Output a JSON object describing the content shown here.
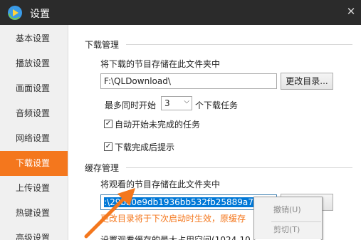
{
  "window": {
    "title": "设置",
    "close_glyph": "✕"
  },
  "sidebar": {
    "items": [
      {
        "label": "基本设置"
      },
      {
        "label": "播放设置"
      },
      {
        "label": "画面设置"
      },
      {
        "label": "音频设置"
      },
      {
        "label": "网络设置"
      },
      {
        "label": "下载设置",
        "active": true
      },
      {
        "label": "上传设置"
      },
      {
        "label": "热键设置"
      },
      {
        "label": "高级设置"
      }
    ]
  },
  "download": {
    "section_title": "下载管理",
    "save_label": "将下载的节目存储在此文件夹中",
    "path_value": "F:\\QLDownload\\",
    "change_dir_button": "更改目录...",
    "concurrent_prefix": "最多同时开始",
    "concurrent_value": "3",
    "concurrent_suffix": "个下载任务",
    "auto_start_label": "自动开始未完成的任务",
    "auto_start_checked": true,
    "done_prompt_label": "下载完成后提示",
    "done_prompt_checked": true
  },
  "cache": {
    "section_title": "缓存管理",
    "save_label": "将观看的节目存储在此文件夹中",
    "path_value": ":\\29ba0e9db1936bb532fb25889a7",
    "warning_text": "更改目录将于下次启动时生效，原缓存",
    "bottom_text": "设置观看缓存的最大占用空间(1024-10"
  },
  "context_menu": {
    "items": [
      {
        "label": "撤销(U)",
        "disabled": true
      },
      {
        "label": "剪切(T)",
        "disabled": true
      },
      {
        "label": "",
        "hover": true
      }
    ]
  },
  "colors": {
    "accent": "#f4771d",
    "title_bar": "#2b2b2b",
    "selection": "#0078d7"
  },
  "icons": {
    "app_logo": "app-logo-icon",
    "close": "close-icon",
    "dropdown": "chevron-down-icon",
    "check": "check-icon",
    "annotation": "orange-arrow-icon"
  }
}
